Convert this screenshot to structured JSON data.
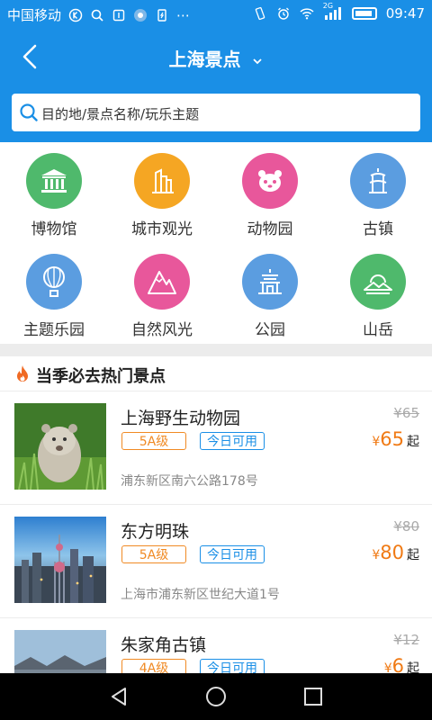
{
  "status": {
    "carrier": "中国移动",
    "network": "2G",
    "time": "09:47"
  },
  "header": {
    "title": "上海景点"
  },
  "search": {
    "placeholder": "目的地/景点名称/玩乐主题"
  },
  "categories": [
    {
      "label": "博物馆",
      "color": "#4fb96c",
      "icon": "museum-icon"
    },
    {
      "label": "城市观光",
      "color": "#f5a623",
      "icon": "city-buildings-icon"
    },
    {
      "label": "动物园",
      "color": "#e8579b",
      "icon": "panda-icon"
    },
    {
      "label": "古镇",
      "color": "#5b9de0",
      "icon": "pagoda-icon"
    },
    {
      "label": "主题乐园",
      "color": "#5b9de0",
      "icon": "hot-air-balloon-icon"
    },
    {
      "label": "自然风光",
      "color": "#e8579b",
      "icon": "mountain-peak-icon"
    },
    {
      "label": "公园",
      "color": "#5b9de0",
      "icon": "temple-icon"
    },
    {
      "label": "山岳",
      "color": "#4fb96c",
      "icon": "mountain-sun-icon"
    }
  ],
  "hot": {
    "title": "当季必去热门景点",
    "items": [
      {
        "name": "上海野生动物园",
        "level": "5A级",
        "today": "今日可用",
        "address": "浦东新区南六公路178号",
        "old_price": "¥65",
        "currency": "¥",
        "price": "65",
        "suffix": "起"
      },
      {
        "name": "东方明珠",
        "level": "5A级",
        "today": "今日可用",
        "address": "上海市浦东新区世纪大道1号",
        "old_price": "¥80",
        "currency": "¥",
        "price": "80",
        "suffix": "起"
      },
      {
        "name": "朱家角古镇",
        "level": "4A级",
        "today": "今日可用",
        "address": "",
        "old_price": "¥12",
        "currency": "¥",
        "price": "6",
        "suffix": "起"
      }
    ]
  }
}
